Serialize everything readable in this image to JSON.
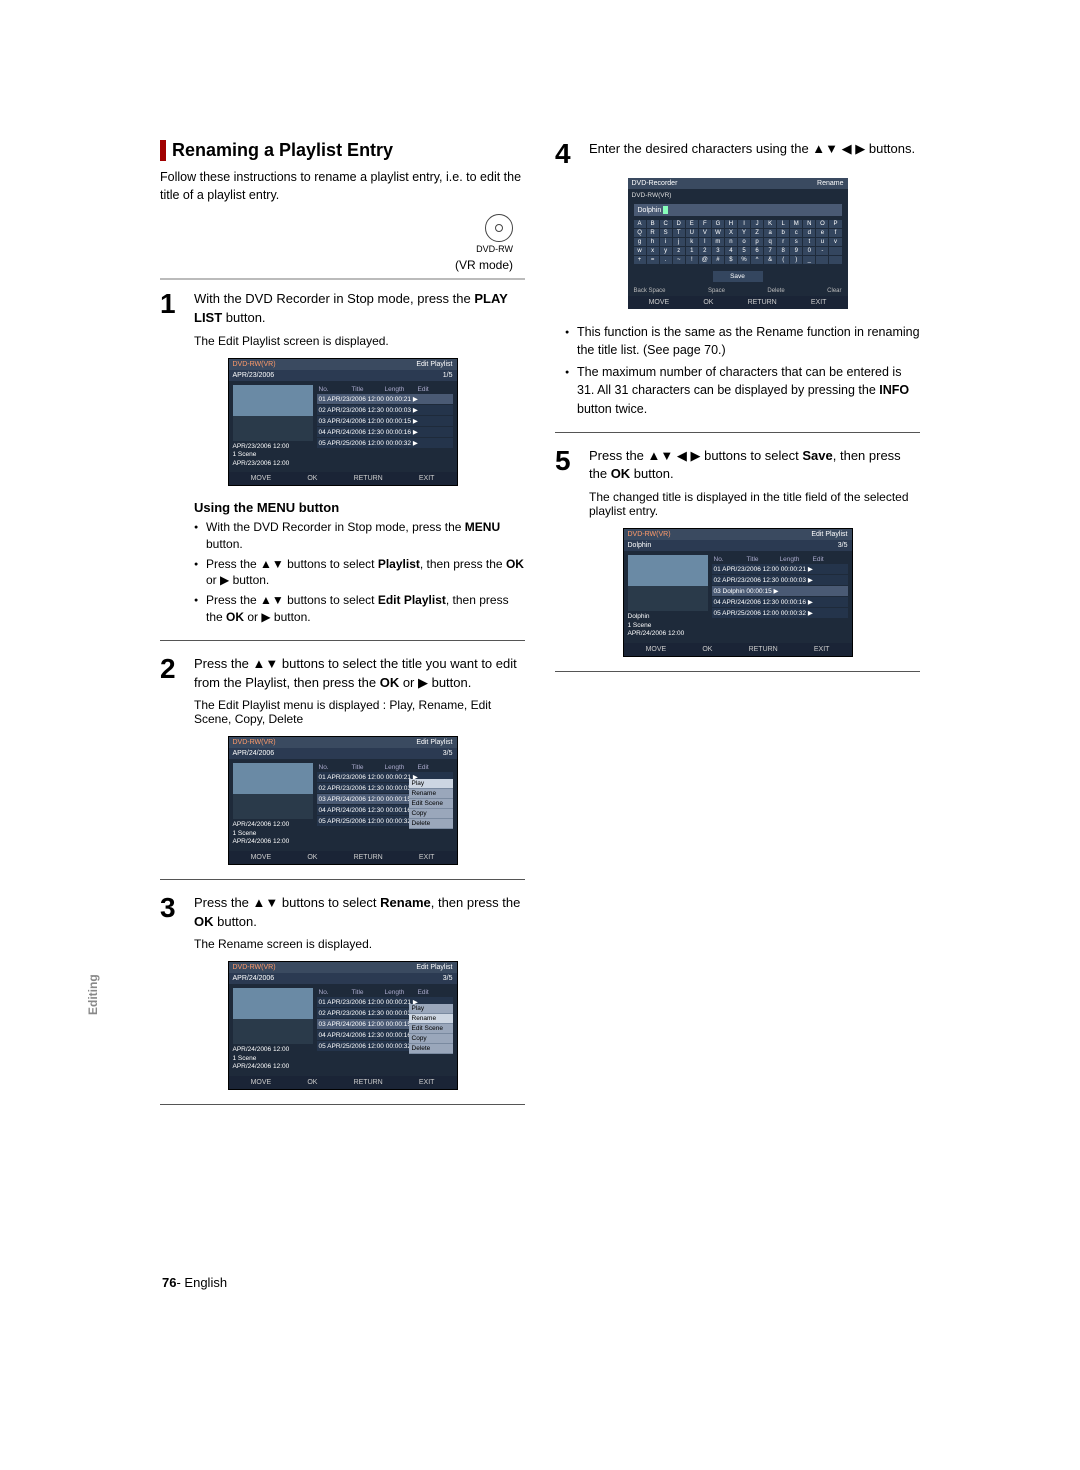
{
  "sideTab": "Editing",
  "footer": {
    "page": "76",
    "sep": "- ",
    "lang": "English"
  },
  "left": {
    "title": "Renaming a Playlist Entry",
    "intro": "Follow these instructions to rename a playlist entry, i.e. to edit the title of a playlist entry.",
    "discLabel": "DVD-RW",
    "vr": "(VR mode)",
    "step1": {
      "num": "1",
      "l1": "With the DVD Recorder in Stop mode, press the ",
      "bold": "PLAY LIST",
      "l2": " button.",
      "sub": "The Edit Playlist screen is displayed."
    },
    "osd1": {
      "disc": "DVD-RW(VR)",
      "titleRight": "Edit Playlist",
      "sub": "APR/23/2006",
      "count": "1/5",
      "hd": [
        "No.",
        "Title",
        "Length",
        "Edit"
      ],
      "rows": [
        "01 APR/23/2006 12:00  00:00:21  ▶",
        "02 APR/23/2006 12:30  00:00:03  ▶",
        "03 APR/24/2006 12:00  00:00:15  ▶",
        "04 APR/24/2006 12:30  00:00:16  ▶",
        "05 APR/25/2006 12:00  00:00:32  ▶"
      ],
      "meta": [
        "APR/23/2006 12:00",
        "1 Scene",
        "APR/23/2006 12:00"
      ],
      "foot": [
        "MOVE",
        "OK",
        "RETURN",
        "EXIT"
      ]
    },
    "menuHead": "Using the MENU button",
    "menu": {
      "b1a": "With the DVD Recorder in Stop mode, press the ",
      "b1b": "MENU",
      "b1c": " button.",
      "b2a": "Press the ▲▼ buttons to select ",
      "b2b": "Playlist",
      "b2c": ", then press the ",
      "b2d": "OK",
      "b2e": " or ▶ button.",
      "b3a": "Press the ▲▼ buttons to select ",
      "b3b": "Edit Playlist",
      "b3c": ", then press the ",
      "b3d": "OK",
      "b3e": " or ▶ button."
    },
    "step2": {
      "num": "2",
      "l1": "Press the ▲▼ buttons to select the title you want to edit from the Playlist, then press the ",
      "b1": "OK",
      "l2": " or ▶ button.",
      "sub": "The Edit Playlist menu is displayed : Play, Rename, Edit Scene, Copy, Delete"
    },
    "osd2": {
      "sub": "APR/24/2006",
      "count": "3/5",
      "ctx": [
        "Play",
        "Rename",
        "Edit Scene",
        "Copy",
        "Delete"
      ],
      "meta": [
        "APR/24/2006 12:00",
        "1 Scene",
        "APR/24/2006 12:00"
      ]
    },
    "step3": {
      "num": "3",
      "l1": "Press the ▲▼ buttons to select ",
      "b1": "Rename",
      "l2": ", then press the ",
      "b2": "OK",
      "l3": " button.",
      "sub": "The Rename screen is displayed."
    },
    "osd3": {
      "sub": "APR/24/2006",
      "count": "3/5",
      "meta": [
        "APR/24/2006 12:00",
        "1 Scene",
        "APR/24/2006 12:00"
      ]
    }
  },
  "right": {
    "step4": {
      "num": "4",
      "l1": "Enter the desired characters using the ▲▼ ◀ ▶ buttons."
    },
    "kb": {
      "top1": "DVD-Recorder",
      "top2": "Rename",
      "subDisc": "DVD-RW(VR)",
      "input": "Dolphin",
      "rows": [
        [
          "A",
          "B",
          "C",
          "D",
          "E",
          "F",
          "G",
          "H",
          "I",
          "J",
          "K",
          "L",
          "M",
          "N",
          "O",
          "P"
        ],
        [
          "Q",
          "R",
          "S",
          "T",
          "U",
          "V",
          "W",
          "X",
          "Y",
          "Z",
          "a",
          "b",
          "c",
          "d",
          "e",
          "f"
        ],
        [
          "g",
          "h",
          "i",
          "j",
          "k",
          "l",
          "m",
          "n",
          "o",
          "p",
          "q",
          "r",
          "s",
          "t",
          "u",
          "v"
        ],
        [
          "w",
          "x",
          "y",
          "z",
          "1",
          "2",
          "3",
          "4",
          "5",
          "6",
          "7",
          "8",
          "9",
          "0",
          "-",
          " "
        ],
        [
          "+",
          "=",
          ".",
          "~",
          "!",
          "@",
          "#",
          "$",
          "%",
          "^",
          "&",
          "(",
          ")",
          "_",
          " ",
          " "
        ]
      ],
      "save": "Save",
      "ops": [
        "Back Space",
        "Space",
        "Delete",
        "Clear"
      ],
      "foot": [
        "MOVE",
        "OK",
        "RETURN",
        "EXIT"
      ]
    },
    "notes": {
      "n1": "This function is the same as the Rename function in renaming the title list. (See page 70.)",
      "n2a": "The maximum number of characters that can be entered is 31. All 31 characters can be displayed by pressing the ",
      "n2b": "INFO",
      "n2c": " button twice."
    },
    "step5": {
      "num": "5",
      "l1": "Press the ▲▼ ◀ ▶ buttons to select ",
      "b1": "Save",
      "l2": ", then press the ",
      "b2": "OK",
      "l3": " button.",
      "sub": "The changed title is displayed in the title field of the selected playlist entry."
    },
    "osd5": {
      "disc": "DVD-RW(VR)",
      "titleRight": "Edit Playlist",
      "sub": "Dolphin",
      "count": "3/5",
      "hd": [
        "No.",
        "Title",
        "Length",
        "Edit"
      ],
      "rows": [
        "01 APR/23/2006 12:00  00:00:21  ▶",
        "02 APR/23/2006 12:30  00:00:03  ▶",
        "03 Dolphin                 00:00:15  ▶",
        "04 APR/24/2006 12:30  00:00:16  ▶",
        "05 APR/25/2006 12:00  00:00:32  ▶"
      ],
      "meta": [
        "Dolphin",
        "1 Scene",
        "APR/24/2006 12:00"
      ],
      "foot": [
        "MOVE",
        "OK",
        "RETURN",
        "EXIT"
      ]
    }
  }
}
